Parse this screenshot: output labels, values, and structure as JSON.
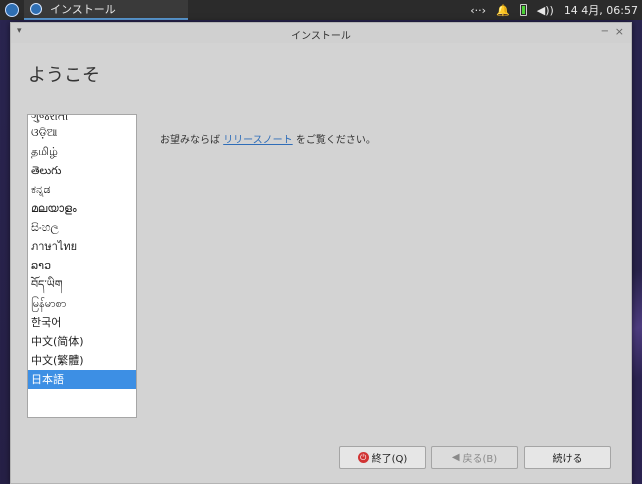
{
  "panel": {
    "task_title": "インストール",
    "network_glyph": "‹··›",
    "bell_glyph": "🔔",
    "volume_glyph": "◀))",
    "clock": "14 4月, 06:57"
  },
  "window": {
    "title": "インストール",
    "menu_glyph": "▾",
    "minimize_glyph": "−",
    "close_glyph": "×"
  },
  "page": {
    "heading": "ようこそ",
    "release_prefix": "お望みならば ",
    "release_link": "リリースノート",
    "release_suffix": " をご覧ください。"
  },
  "languages": [
    {
      "label": "ગુજરાતી",
      "partial": true
    },
    {
      "label": "ଓଡ଼ିଆ"
    },
    {
      "label": "தமிழ்"
    },
    {
      "label": "తెలుగు"
    },
    {
      "label": "ಕನ್ನಡ"
    },
    {
      "label": "മലയാളം"
    },
    {
      "label": "සිංහල"
    },
    {
      "label": "ภาษาไทย"
    },
    {
      "label": "ລາວ"
    },
    {
      "label": "བོད་ཡིག"
    },
    {
      "label": "မြန်မာစာ"
    },
    {
      "label": "한국어"
    },
    {
      "label": "中文(简体)"
    },
    {
      "label": "中文(繁體)"
    },
    {
      "label": "日本語",
      "selected": true
    }
  ],
  "buttons": {
    "quit": "終了(Q)",
    "back": "戻る(B)",
    "continue": "続ける"
  },
  "colors": {
    "selection": "#3d8fe4",
    "link": "#2f6db8",
    "quit_icon": "#d13434"
  }
}
